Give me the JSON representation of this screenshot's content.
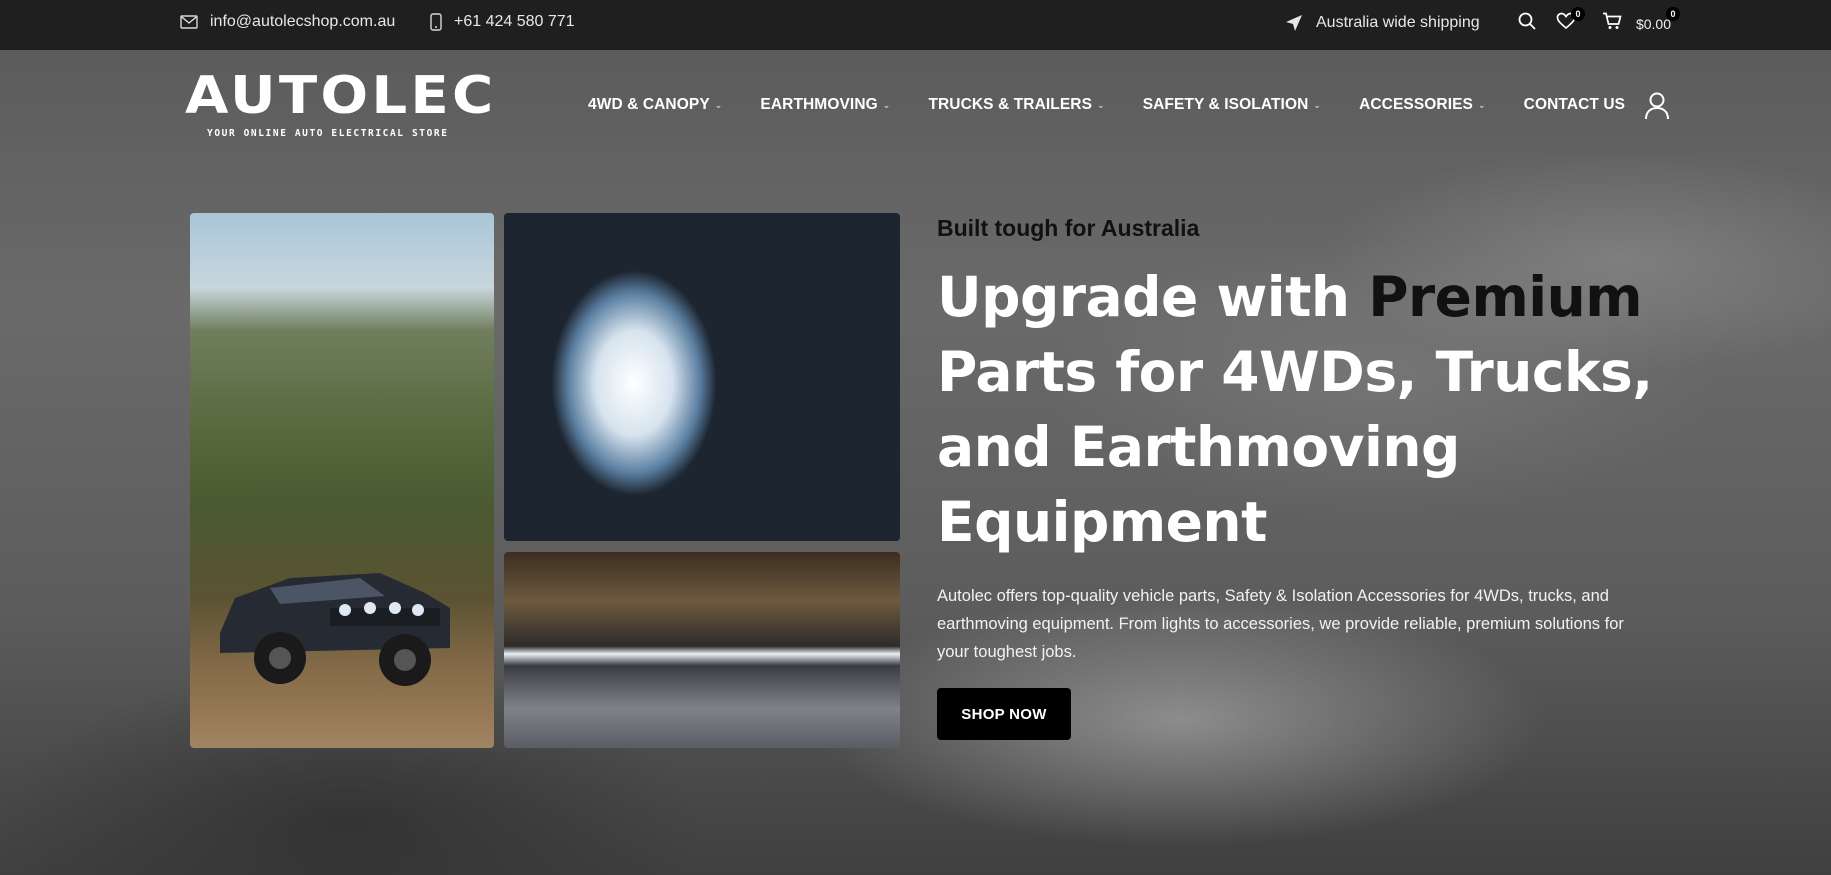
{
  "topbar": {
    "email": "info@autolecshop.com.au",
    "phone": "+61 424 580 771",
    "shipping": "Australia wide shipping",
    "wishlist_count": "0",
    "cart_count": "0",
    "cart_total": "$0.00"
  },
  "header": {
    "logo_text": "AUTOLEC",
    "logo_tagline": "YOUR ONLINE AUTO ELECTRICAL STORE",
    "nav": [
      {
        "label": "4WD & CANOPY"
      },
      {
        "label": "EARTHMOVING"
      },
      {
        "label": "TRUCKS & TRAILERS"
      },
      {
        "label": "SAFETY & ISOLATION"
      },
      {
        "label": "ACCESSORIES"
      },
      {
        "label": "CONTACT US"
      }
    ]
  },
  "hero": {
    "eyebrow": "Built tough for Australia",
    "headline_pre": "Upgrade with ",
    "headline_accent": "Premium",
    "headline_post": "Parts for 4WDs, Trucks, and Earthmoving Equipment",
    "lead": "Autolec offers top-quality vehicle parts, Safety & Isolation Accessories for 4WDs, trucks, and earthmoving equipment. From lights to accessories, we provide reliable, premium solutions for your toughest jobs.",
    "cta": "SHOP NOW"
  },
  "colors": {
    "topbar_bg": "#1f1f1f",
    "accent_text": "#111111",
    "button_bg": "#000000"
  },
  "icons": [
    "envelope-icon",
    "phone-icon",
    "location-arrow-icon",
    "search-icon",
    "heart-icon",
    "cart-icon",
    "user-icon",
    "chevron-down-icon"
  ]
}
